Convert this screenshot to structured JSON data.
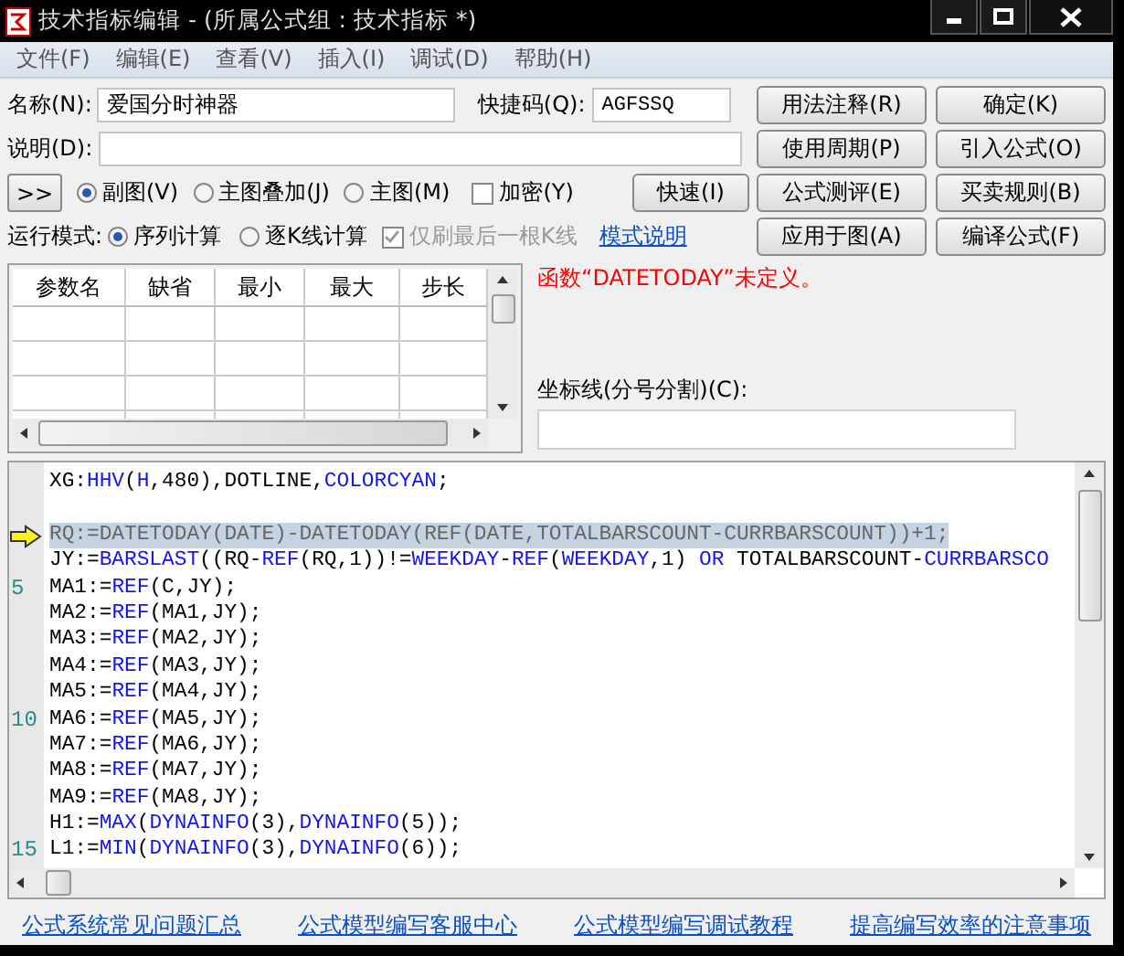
{
  "window": {
    "title": "技术指标编辑 - (所属公式组 : 技术指标 *)"
  },
  "menu": [
    "文件(F)",
    "编辑(E)",
    "查看(V)",
    "插入(I)",
    "调试(D)",
    "帮助(H)"
  ],
  "form": {
    "name_label": "名称(N):",
    "name_value": "爱国分时神器",
    "shortcut_label": "快捷码(Q):",
    "shortcut_value": "AGFSSQ",
    "desc_label": "说明(D):",
    "expand_button": ">>",
    "chart_types": [
      {
        "label": "副图(V)",
        "selected": true
      },
      {
        "label": "主图叠加(J)",
        "selected": false
      },
      {
        "label": "主图(M)",
        "selected": false
      }
    ],
    "encrypt": {
      "label": "加密(Y)",
      "checked": false
    },
    "quick_button": "快速(I)",
    "run_mode_label": "运行模式:",
    "run_modes": [
      {
        "label": "序列计算",
        "selected": true
      },
      {
        "label": "逐K线计算",
        "selected": false
      }
    ],
    "refresh_last": {
      "label": "仅刷最后一根K线",
      "checked": true,
      "disabled": true
    },
    "mode_link": "模式说明"
  },
  "side_buttons": [
    [
      "用法注释(R)",
      "确定(K)"
    ],
    [
      "使用周期(P)",
      "引入公式(O)"
    ],
    [
      "公式测评(E)",
      "买卖规则(B)"
    ],
    [
      "应用于图(A)",
      "编译公式(F)"
    ]
  ],
  "param_table": {
    "columns": [
      "参数名",
      "缺省",
      "最小",
      "最大",
      "步长"
    ]
  },
  "error_message": "函数“DATETODAY”未定义。",
  "axis_label": "坐标线(分号分割)(C):",
  "code_lines": [
    {
      "marked": false,
      "tokens": [
        {
          "text": "XG:",
          "kind": "plain"
        },
        {
          "text": "HHV",
          "kind": "fn"
        },
        {
          "text": "(",
          "kind": "plain"
        },
        {
          "text": "H",
          "kind": "fn"
        },
        {
          "text": ",480),DOTLINE,",
          "kind": "plain"
        },
        {
          "text": "COLORCYAN",
          "kind": "fn"
        },
        {
          "text": ";",
          "kind": "plain"
        }
      ]
    },
    {
      "marked": true,
      "blank_line_before": true,
      "tokens": [
        {
          "text": "RQ:=DATETODAY(DATE)-DATETODAY(REF(DATE,TOTALBARSCOUNT-CURRBARSCOUNT))+1;",
          "kind": "plain"
        }
      ]
    },
    {
      "marked": false,
      "tokens": [
        {
          "text": "JY:=",
          "kind": "plain"
        },
        {
          "text": "BARSLAST",
          "kind": "fn"
        },
        {
          "text": "((RQ-",
          "kind": "plain"
        },
        {
          "text": "REF",
          "kind": "fn"
        },
        {
          "text": "(RQ,1))!=",
          "kind": "plain"
        },
        {
          "text": "WEEKDAY",
          "kind": "fn"
        },
        {
          "text": "-",
          "kind": "plain"
        },
        {
          "text": "REF",
          "kind": "fn"
        },
        {
          "text": "(",
          "kind": "plain"
        },
        {
          "text": "WEEKDAY",
          "kind": "fn"
        },
        {
          "text": ",1) ",
          "kind": "plain"
        },
        {
          "text": "OR",
          "kind": "fn"
        },
        {
          "text": " TOTALBARSCOUNT-",
          "kind": "plain"
        },
        {
          "text": "CURRBARSCO",
          "kind": "fn"
        }
      ]
    },
    {
      "number": "5",
      "marked": false,
      "tokens": [
        {
          "text": "MA1:=",
          "kind": "plain"
        },
        {
          "text": "REF",
          "kind": "fn"
        },
        {
          "text": "(C,JY);",
          "kind": "plain"
        }
      ]
    },
    {
      "marked": false,
      "tokens": [
        {
          "text": "MA2:=",
          "kind": "plain"
        },
        {
          "text": "REF",
          "kind": "fn"
        },
        {
          "text": "(MA1,JY);",
          "kind": "plain"
        }
      ]
    },
    {
      "marked": false,
      "tokens": [
        {
          "text": "MA3:=",
          "kind": "plain"
        },
        {
          "text": "REF",
          "kind": "fn"
        },
        {
          "text": "(MA2,JY);",
          "kind": "plain"
        }
      ]
    },
    {
      "marked": false,
      "tokens": [
        {
          "text": "MA4:=",
          "kind": "plain"
        },
        {
          "text": "REF",
          "kind": "fn"
        },
        {
          "text": "(MA3,JY);",
          "kind": "plain"
        }
      ]
    },
    {
      "marked": false,
      "tokens": [
        {
          "text": "MA5:=",
          "kind": "plain"
        },
        {
          "text": "REF",
          "kind": "fn"
        },
        {
          "text": "(MA4,JY);",
          "kind": "plain"
        }
      ]
    },
    {
      "number": "10",
      "marked": false,
      "tokens": [
        {
          "text": "MA6:=",
          "kind": "plain"
        },
        {
          "text": "REF",
          "kind": "fn"
        },
        {
          "text": "(MA5,JY);",
          "kind": "plain"
        }
      ]
    },
    {
      "marked": false,
      "tokens": [
        {
          "text": "MA7:=",
          "kind": "plain"
        },
        {
          "text": "REF",
          "kind": "fn"
        },
        {
          "text": "(MA6,JY);",
          "kind": "plain"
        }
      ]
    },
    {
      "marked": false,
      "tokens": [
        {
          "text": "MA8:=",
          "kind": "plain"
        },
        {
          "text": "REF",
          "kind": "fn"
        },
        {
          "text": "(MA7,JY);",
          "kind": "plain"
        }
      ]
    },
    {
      "marked": false,
      "tokens": [
        {
          "text": "MA9:=",
          "kind": "plain"
        },
        {
          "text": "REF",
          "kind": "fn"
        },
        {
          "text": "(MA8,JY);",
          "kind": "plain"
        }
      ]
    },
    {
      "marked": false,
      "tokens": [
        {
          "text": "H1:=",
          "kind": "plain"
        },
        {
          "text": "MAX",
          "kind": "fn"
        },
        {
          "text": "(",
          "kind": "plain"
        },
        {
          "text": "DYNAINFO",
          "kind": "fn"
        },
        {
          "text": "(3),",
          "kind": "plain"
        },
        {
          "text": "DYNAINFO",
          "kind": "fn"
        },
        {
          "text": "(5));",
          "kind": "plain"
        }
      ]
    },
    {
      "number": "15",
      "marked": false,
      "tokens": [
        {
          "text": "L1:=",
          "kind": "plain"
        },
        {
          "text": "MIN",
          "kind": "fn"
        },
        {
          "text": "(",
          "kind": "plain"
        },
        {
          "text": "DYNAINFO",
          "kind": "fn"
        },
        {
          "text": "(3),",
          "kind": "plain"
        },
        {
          "text": "DYNAINFO",
          "kind": "fn"
        },
        {
          "text": "(6));",
          "kind": "plain"
        }
      ]
    }
  ],
  "footer_links": [
    "公式系统常见问题汇总",
    "公式模型编写客服中心",
    "公式模型编写调试教程",
    "提高编写效率的注意事项"
  ]
}
